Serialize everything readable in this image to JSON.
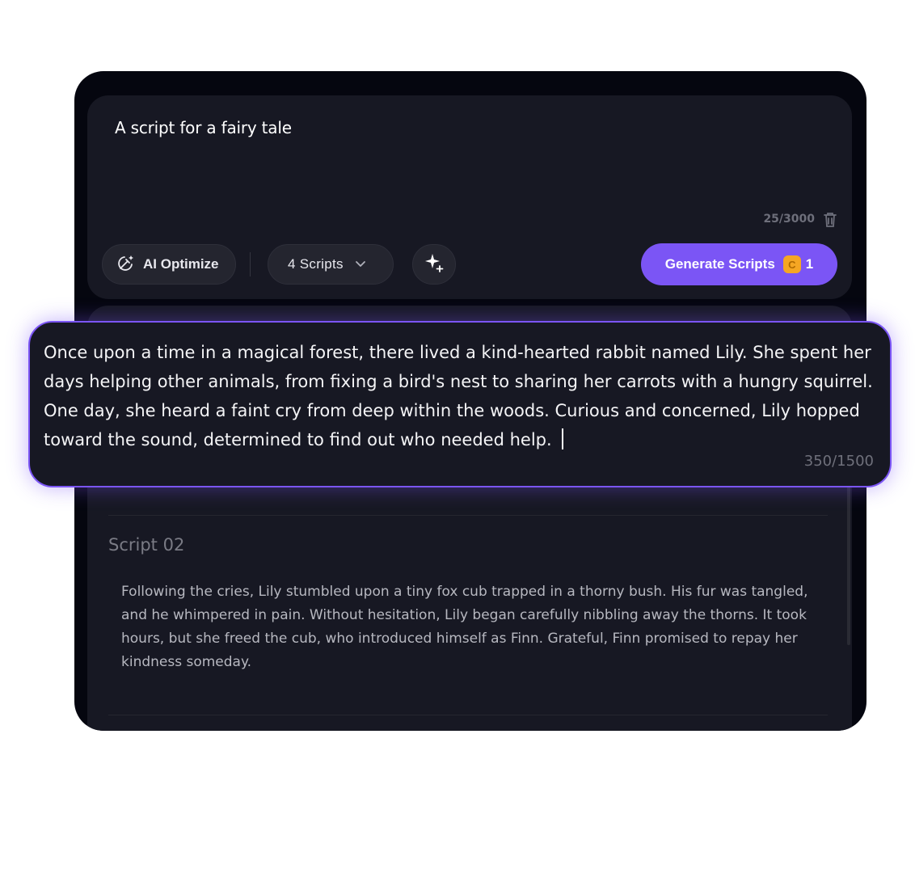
{
  "prompt": {
    "text": "A script for a fairy tale",
    "counter": "25/3000"
  },
  "toolbar": {
    "optimize_label": "AI Optimize",
    "scripts_label": "4 Scripts",
    "generate_label": "Generate Scripts",
    "coin_symbol": "C",
    "cost": "1"
  },
  "active_script": {
    "text": "Once upon a time in a magical forest, there lived a kind-hearted rabbit named Lily. She spent her days helping other animals, from fixing a bird's nest to sharing her carrots with a hungry squirrel. One day, she heard a faint cry from deep within the woods. Curious and concerned, Lily hopped toward the sound, determined to find out who needed help.",
    "counter": "350/1500"
  },
  "scripts": [
    {
      "title": "Script 02",
      "text": "Following the cries, Lily stumbled upon a tiny fox cub trapped in a thorny bush. His fur was tangled, and he whimpered in pain. Without hesitation, Lily began carefully nibbling away the thorns. It took hours, but she freed the cub, who introduced himself as Finn. Grateful, Finn promised to repay her kindness someday."
    }
  ],
  "colors": {
    "accent": "#7b55f5",
    "background": "#05060f",
    "card": "#171823"
  },
  "icons": [
    "ai-optimize-icon",
    "chevron-down-icon",
    "sparkle-add-icon",
    "trash-icon",
    "coin-icon"
  ]
}
